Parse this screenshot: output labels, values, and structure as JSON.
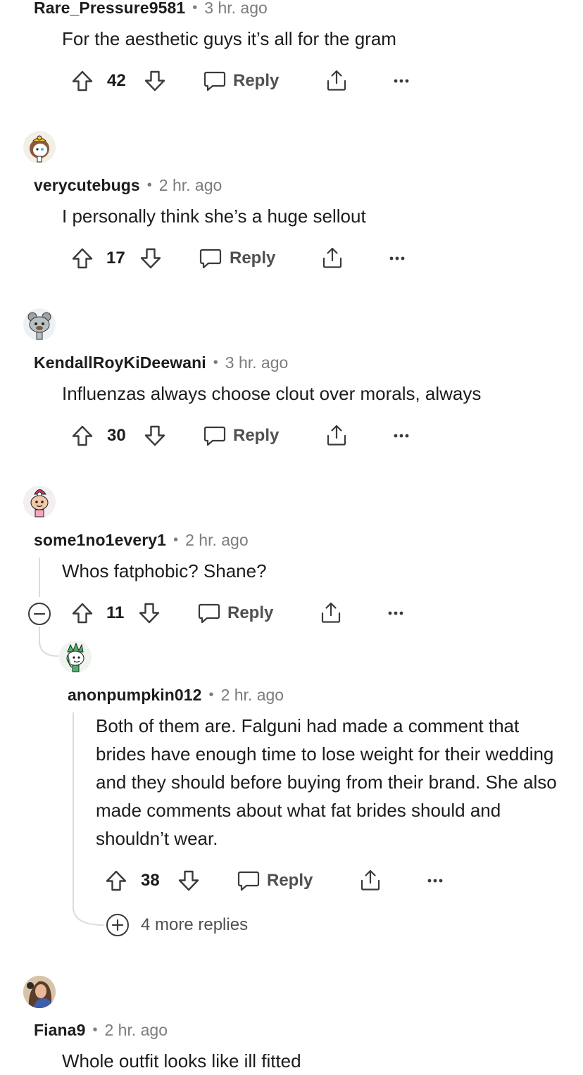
{
  "comments": [
    {
      "username": "Rare_Pressure9581",
      "separator": "•",
      "time": "3 hr. ago",
      "text": "For the aesthetic guys it’s all for the gram",
      "votes": "42",
      "reply_label": "Reply",
      "avatar_icon": "snoo-avatar-icon"
    },
    {
      "username": "verycutebugs",
      "separator": "•",
      "time": "2 hr. ago",
      "text": "I personally think she’s a huge sellout",
      "votes": "17",
      "reply_label": "Reply",
      "avatar_icon": "snoo-avatar-icon"
    },
    {
      "username": "KendallRoyKiDeewani",
      "separator": "•",
      "time": "3 hr. ago",
      "text": "Influenzas always choose clout over morals, always",
      "votes": "30",
      "reply_label": "Reply",
      "avatar_icon": "snoo-avatar-icon"
    },
    {
      "username": "some1no1every1",
      "separator": "•",
      "time": "2 hr. ago",
      "text": "Whos fatphobic? Shane?",
      "votes": "11",
      "reply_label": "Reply",
      "avatar_icon": "snoo-avatar-icon",
      "replies": [
        {
          "username": "anonpumpkin012",
          "separator": "•",
          "time": "2 hr. ago",
          "text": "Both of them are. Falguni had made a comment that brides have enough time to lose weight for their wedding and they should before buying from their brand. She also made comments about what fat brides should and shouldn’t wear.",
          "votes": "38",
          "reply_label": "Reply",
          "avatar_icon": "snoo-avatar-icon"
        }
      ],
      "more_replies_label": "4 more replies"
    },
    {
      "username": "Fiana9",
      "separator": "•",
      "time": "2 hr. ago",
      "text": "Whole outfit looks like ill fitted",
      "avatar_icon": "user-photo-avatar"
    }
  ],
  "icons": {
    "upvote": "upvote-arrow-icon",
    "downvote": "downvote-arrow-icon",
    "reply": "speech-bubble-icon",
    "share": "share-icon",
    "more": "ellipsis-icon",
    "collapse": "collapse-minus-icon",
    "expand": "expand-plus-icon"
  },
  "colors": {
    "text_primary": "#1c1c1c",
    "text_secondary": "#7c7c7c",
    "action_text": "#505050",
    "icon": "#3a3a3a",
    "thread_line": "#dcdcdc"
  }
}
